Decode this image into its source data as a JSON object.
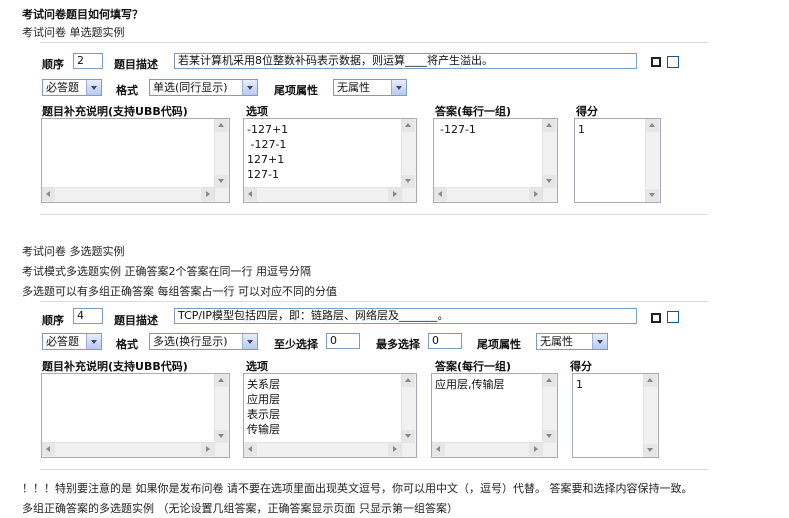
{
  "header": {
    "title": "考试问卷题目如何填写？",
    "single_example": "考试问卷 单选题实例"
  },
  "q1": {
    "order_label": "顺序",
    "order_value": "2",
    "desc_label": "题目描述",
    "desc_value": "若某计算机采用8位整数补码表示数据，则运算____将产生溢出。",
    "required_value": "必答题",
    "format_label": "格式",
    "format_value": "单选(同行显示)",
    "tail_label": "尾项属性",
    "tail_value": "无属性",
    "note_header": "题目补充说明(支持UBB代码)",
    "options_header": "选项",
    "options": [
      "-127+1",
      " -127-1",
      "127+1",
      "127-1"
    ],
    "answer_header": "答案(每行一组)",
    "answer_value": "-127-1",
    "score_header": "得分",
    "score_value": "1"
  },
  "mid": {
    "multi_example": "考试问卷 多选题实例",
    "line2": "考试模式多选题实例 正确答案2个答案在同一行 用逗号分隔",
    "line3": "多选题可以有多组正确答案 每组答案占一行 可以对应不同的分值"
  },
  "q2": {
    "order_label": "顺序",
    "order_value": "4",
    "desc_label": "题目描述",
    "desc_value": "TCP/IP模型包括四层，即：链路层、网络层及_______。",
    "required_value": "必答题",
    "format_label": "格式",
    "format_value": "多选(换行显示)",
    "min_label": "至少选择",
    "min_value": "0",
    "max_label": "最多选择",
    "max_value": "0",
    "tail_label": "尾项属性",
    "tail_value": "无属性",
    "note_header": "题目补充说明(支持UBB代码)",
    "options_header": "选项",
    "options": [
      "关系层",
      "应用层",
      "表示层",
      "传输层"
    ],
    "answer_header": "答案(每行一组)",
    "answer_value": "应用层,传输层",
    "score_header": "得分",
    "score_value": "1"
  },
  "footer": {
    "warning": "！！！特别要注意的是 如果你是发布问卷 请不要在选项里面出现英文逗号，你可以用中文（，逗号）代替。 答案要和选择内容保持一致。",
    "last": "多组正确答案的多选题实例 （无论设置几组答案，正确答案显示页面 只显示第一组答案）"
  },
  "colors": {
    "input_border": "#7f9db9",
    "box_border": "#a5acb5",
    "checkbox_border": "#1c5180"
  }
}
